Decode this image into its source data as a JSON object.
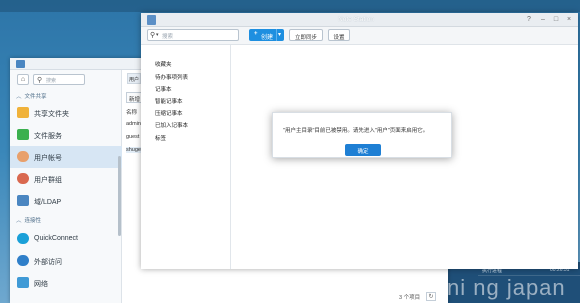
{
  "note_station": {
    "title": "Note Station",
    "search_placeholder": "搜索",
    "create_label": "创建",
    "sync_button": "立即同步",
    "settings_button": "设置",
    "nav": [
      "收藏夹",
      "待办事项列表",
      "记事本",
      "智能记事本",
      "压缩记事本",
      "已加入记事本",
      "标签"
    ]
  },
  "control_panel": {
    "search_placeholder": "搜索",
    "sections": {
      "file_sharing": "文件共享",
      "connectivity": "连接性"
    },
    "items": [
      {
        "label": "共享文件夹",
        "icon": "shared-folder-icon"
      },
      {
        "label": "文件服务",
        "icon": "file-services-icon"
      },
      {
        "label": "用户帐号",
        "icon": "user-icon"
      },
      {
        "label": "用户群组",
        "icon": "group-icon"
      },
      {
        "label": "域/LDAP",
        "icon": "domain-icon"
      },
      {
        "label": "QuickConnect",
        "icon": "quickconnect-icon"
      },
      {
        "label": "外部访问",
        "icon": "external-access-icon"
      },
      {
        "label": "网络",
        "icon": "network-icon"
      }
    ],
    "tab_label": "用户",
    "new_button": "新增",
    "rows": [
      "名称",
      "admin",
      "guest",
      "shuge"
    ],
    "footer_count": "3 个项目"
  },
  "dialog": {
    "message": "\"用户主目录\"目前已被禁用。请先进入\"用户\"页面来启用它。",
    "ok_label": "确定"
  },
  "desktop": {
    "widget_lines": [
      "执行进程",
      "00:26:51"
    ],
    "watermark": "ni ng japan"
  },
  "colors": {
    "accent": "#1e8fe0",
    "active_item": "#d7e6f4"
  }
}
